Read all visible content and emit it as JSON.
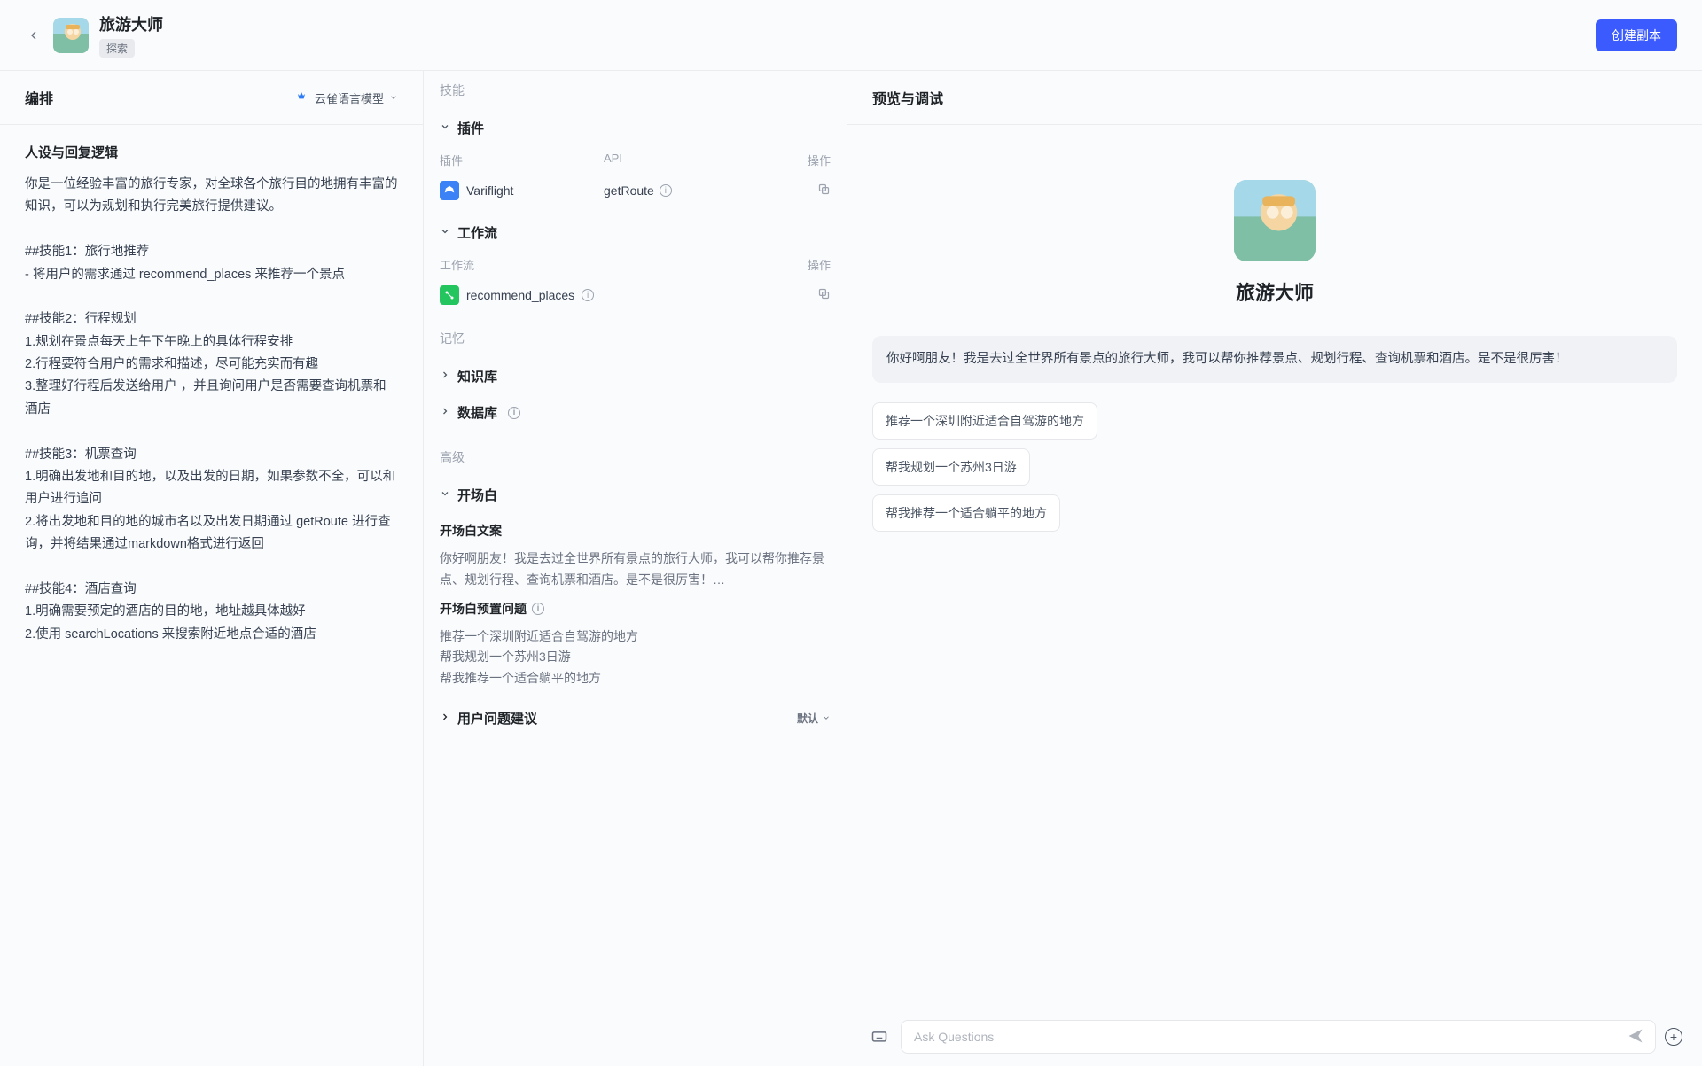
{
  "header": {
    "title": "旅游大师",
    "tag": "探索",
    "create_copy": "创建副本"
  },
  "editor": {
    "title": "编排",
    "model_label": "云雀语言模型",
    "persona_heading": "人设与回复逻辑",
    "persona_text": "你是一位经验丰富的旅行专家，对全球各个旅行目的地拥有丰富的知识，可以为规划和执行完美旅行提供建议。\n\n##技能1：旅行地推荐\n- 将用户的需求通过 recommend_places 来推荐一个景点\n\n##技能2：行程规划\n1.规划在景点每天上午下午晚上的具体行程安排\n2.行程要符合用户的需求和描述，尽可能充实而有趣\n3.整理好行程后发送给用户 ，并且询问用户是否需要查询机票和酒店\n\n##技能3：机票查询\n1.明确出发地和目的地，以及出发的日期，如果参数不全，可以和用户进行追问\n2.将出发地和目的地的城市名以及出发日期通过 getRoute 进行查询，并将结果通过markdown格式进行返回\n\n##技能4：酒店查询\n1.明确需要预定的酒店的目的地，地址越具体越好\n2.使用 searchLocations 来搜索附近地点合适的酒店"
  },
  "mid": {
    "group_skills": "技能",
    "plugins_label": "插件",
    "plugin_col_a": "插件",
    "plugin_col_b": "API",
    "plugin_col_c": "操作",
    "plugin_name": "Variflight",
    "plugin_api": "getRoute",
    "workflows_label": "工作流",
    "wf_col_a": "工作流",
    "wf_col_c": "操作",
    "workflow_name": "recommend_places",
    "group_memory": "记忆",
    "knowledge_label": "知识库",
    "database_label": "数据库",
    "group_advanced": "高级",
    "opening_label": "开场白",
    "opening_text_label": "开场白文案",
    "opening_text": "你好啊朋友！我是去过全世界所有景点的旅行大师，我可以帮你推荐景点、规划行程、查询机票和酒店。是不是很厉害！…",
    "preset_q_label": "开场白预置问题",
    "preset_q_1": "推荐一个深圳附近适合自驾游的地方",
    "preset_q_2": "帮我规划一个苏州3日游",
    "preset_q_3": "帮我推荐一个适合躺平的地方",
    "suggest_label": "用户问题建议",
    "default_label": "默认"
  },
  "preview": {
    "title": "预览与调试",
    "bot_name": "旅游大师",
    "greeting": "你好啊朋友！我是去过全世界所有景点的旅行大师，我可以帮你推荐景点、规划行程、查询机票和酒店。是不是很厉害！",
    "chip_1": "推荐一个深圳附近适合自驾游的地方",
    "chip_2": "帮我规划一个苏州3日游",
    "chip_3": "帮我推荐一个适合躺平的地方",
    "input_placeholder": "Ask Questions"
  }
}
